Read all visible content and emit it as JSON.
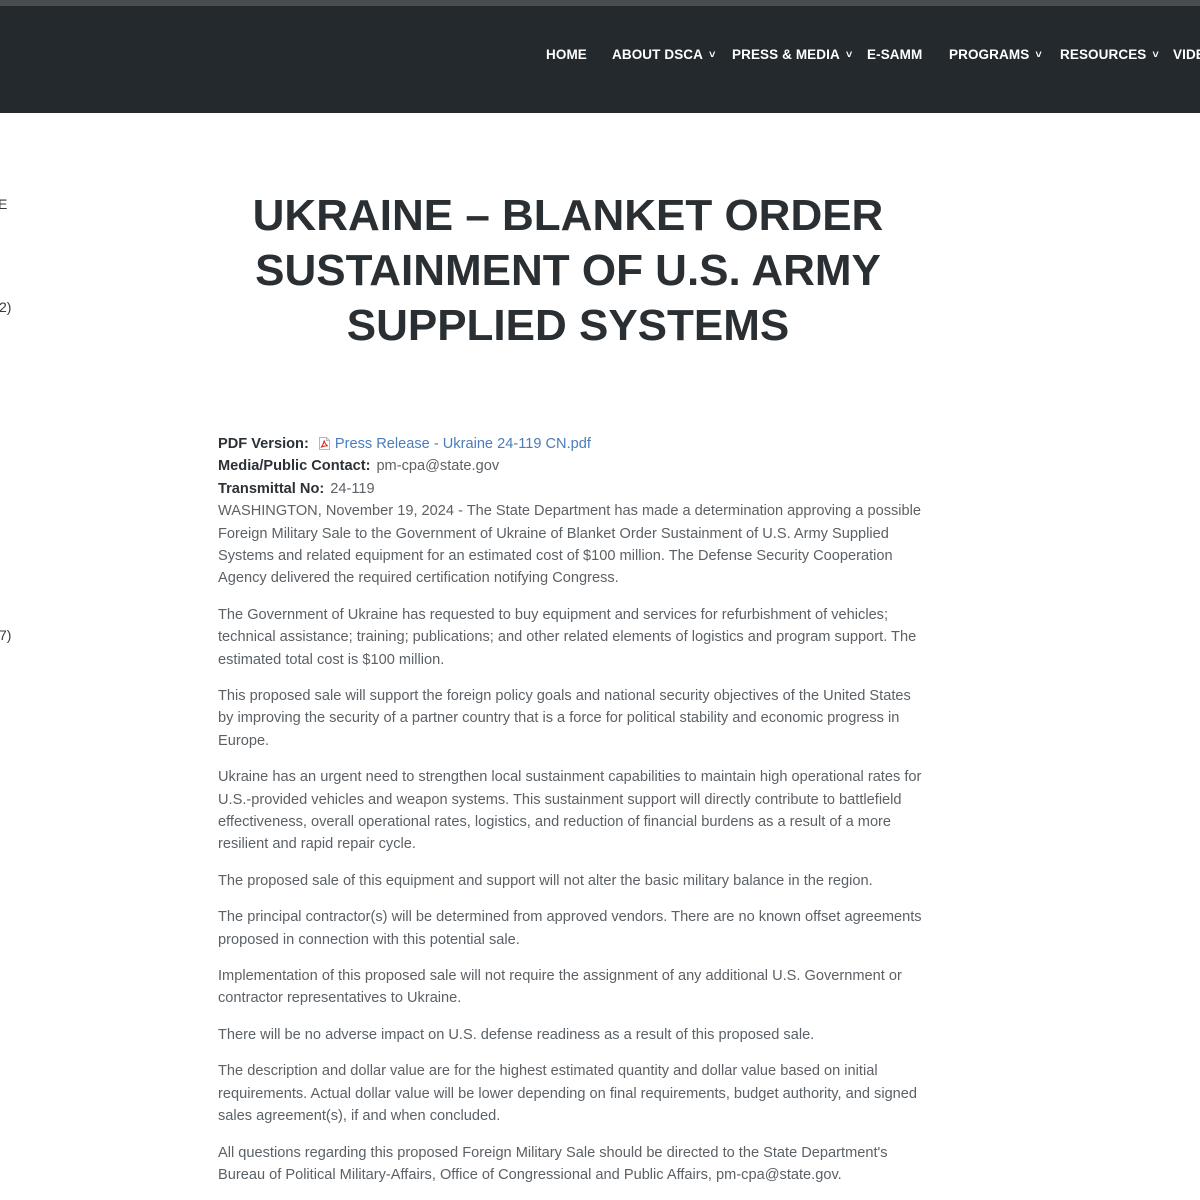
{
  "nav": {
    "items": [
      {
        "label": "HOME",
        "has_dropdown": false
      },
      {
        "label": "ABOUT DSCA",
        "has_dropdown": true
      },
      {
        "label": "PRESS & MEDIA",
        "has_dropdown": true
      },
      {
        "label": "E-SAMM",
        "has_dropdown": false
      },
      {
        "label": "PROGRAMS",
        "has_dropdown": true
      },
      {
        "label": "RESOURCES",
        "has_dropdown": true
      },
      {
        "label": "VIDE",
        "has_dropdown": false
      }
    ],
    "chevron": "˅",
    "background": "#24292d",
    "text_color": "#ffffff"
  },
  "sidebar_fragments": [
    "E",
    "2)",
    "7)"
  ],
  "article": {
    "title_lines": [
      "UKRAINE – BLANKET ORDER",
      "SUSTAINMENT OF U.S. ARMY",
      "SUPPLIED SYSTEMS"
    ],
    "pdf_label": "PDF Version:",
    "pdf_icon": "pdf-file-icon",
    "pdf_link": "Press Release - Ukraine 24-119 CN.pdf",
    "contact_label": "Media/Public Contact:",
    "contact_value": "pm-cpa@state.gov",
    "transmittal_label": "Transmittal No:",
    "transmittal_value": "24-119",
    "paragraphs": [
      "WASHINGTON, November 19, 2024 - The State Department has made a determination approving a possible Foreign Military Sale to the Government of Ukraine of Blanket Order Sustainment of U.S. Army Supplied Systems and related equipment for an estimated cost of $100 million. The Defense Security Cooperation Agency delivered the required certification notifying Congress.",
      "The Government of Ukraine has requested to buy equipment and services for refurbishment of vehicles; technical assistance; training; publications; and other related elements of logistics and program support. The estimated total cost is $100 million.",
      "This proposed sale will support the foreign policy goals and national security objectives of the United States by improving the security of a partner country that is a force for political stability and economic progress in Europe.",
      "Ukraine has an urgent need to strengthen local sustainment capabilities to maintain high operational rates for U.S.-provided vehicles and weapon systems. This sustainment support will directly contribute to battlefield effectiveness, overall operational rates, logistics, and reduction of financial burdens as a result of a more resilient and rapid repair cycle.",
      "The proposed sale of this equipment and support will not alter the basic military balance in the region.",
      "The principal contractor(s) will be determined from approved vendors. There are no known offset agreements proposed in connection with this potential sale.",
      "Implementation of this proposed sale will not require the assignment of any additional U.S. Government or contractor representatives to Ukraine.",
      "There will be no adverse impact on U.S. defense readiness as a result of this proposed sale.",
      "The description and dollar value are for the highest estimated quantity and dollar value based on initial requirements. Actual dollar value will be lower depending on final requirements, budget authority, and signed sales agreement(s), if and when concluded.",
      "All questions regarding this proposed Foreign Military Sale should be directed to the State Department's Bureau of Political Military-Affairs, Office of Congressional and Public Affairs, pm-cpa@state.gov."
    ]
  }
}
